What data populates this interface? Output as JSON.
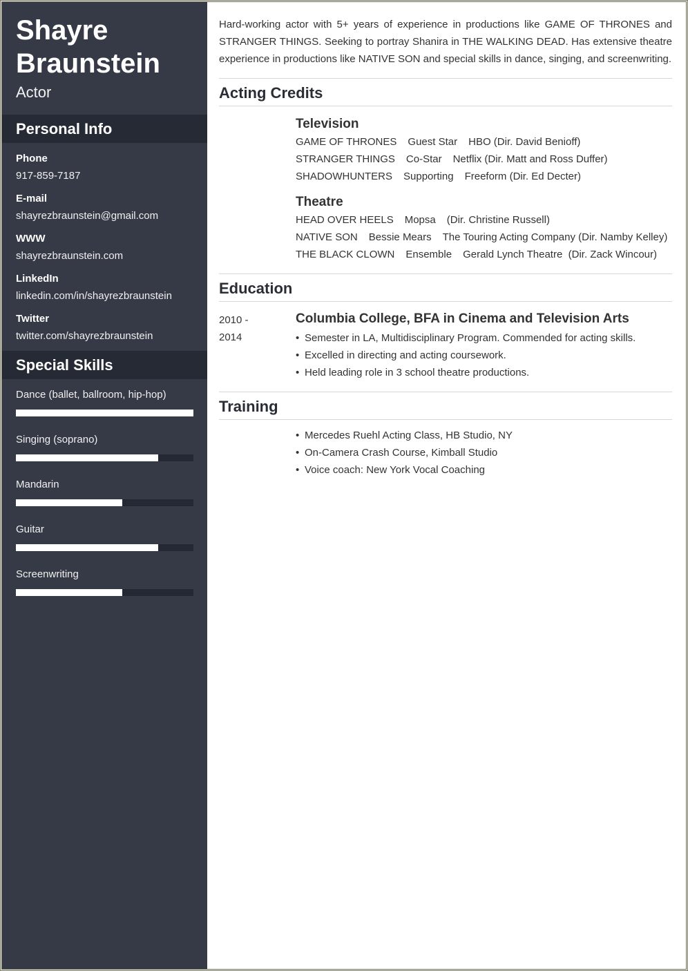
{
  "header": {
    "first_name": "Shayre",
    "last_name": "Braunstein",
    "role": "Actor"
  },
  "personal_info": {
    "title": "Personal Info",
    "items": [
      {
        "label": "Phone",
        "value": "917-859-7187"
      },
      {
        "label": "E-mail",
        "value": "shayrezbraunstein@gmail.com"
      },
      {
        "label": "WWW",
        "value": "shayrezbraunstein.com"
      },
      {
        "label": "LinkedIn",
        "value": "linkedin.com/in/shayrezbraunstein"
      },
      {
        "label": "Twitter",
        "value": "twitter.com/shayrezbraunstein"
      }
    ]
  },
  "skills": {
    "title": "Special Skills",
    "items": [
      {
        "label": "Dance (ballet, ballroom, hip-hop)",
        "level": 1.0
      },
      {
        "label": "Singing (soprano)",
        "level": 0.8
      },
      {
        "label": "Mandarin",
        "level": 0.6
      },
      {
        "label": "Guitar",
        "level": 0.8
      },
      {
        "label": "Screenwriting",
        "level": 0.6
      }
    ]
  },
  "summary": "Hard-working actor with 5+ years of experience in productions like GAME OF THRONES and STRANGER THINGS. Seeking to portray Shanira in THE WALKING DEAD. Has extensive theatre experience in productions like NATIVE SON and special skills in dance, singing, and screenwriting.",
  "acting_credits": {
    "title": "Acting Credits",
    "groups": [
      {
        "title": "Television",
        "credits": [
          {
            "production": "GAME OF THRONES",
            "role": "Guest Star",
            "company": "HBO (Dir. David Benioff)"
          },
          {
            "production": "STRANGER THINGS",
            "role": "Co-Star",
            "company": "Netflix (Dir. Matt and Ross Duffer)"
          },
          {
            "production": "SHADOWHUNTERS",
            "role": "Supporting",
            "company": "Freeform (Dir. Ed Decter)"
          }
        ]
      },
      {
        "title": "Theatre",
        "credits": [
          {
            "production": "HEAD OVER HEELS",
            "role": "Mopsa",
            "company": "(Dir. Christine Russell)"
          },
          {
            "production": "NATIVE SON",
            "role": "Bessie Mears",
            "company": "The Touring Acting Company (Dir. Namby Kelley)"
          },
          {
            "production": "THE BLACK CLOWN",
            "role": "Ensemble",
            "company": "Gerald Lynch Theatre  (Dir. Zack Wincour)"
          }
        ]
      }
    ]
  },
  "education": {
    "title": "Education",
    "entries": [
      {
        "date_start": "2010 -",
        "date_end": "2014",
        "degree": "Columbia College, BFA in Cinema and Television Arts",
        "bullets": [
          "Semester in LA, Multidisciplinary Program. Commended for acting skills.",
          "Excelled in directing and acting coursework.",
          "Held leading role in 3 school theatre productions."
        ]
      }
    ]
  },
  "training": {
    "title": "Training",
    "bullets": [
      "Mercedes Ruehl Acting Class, HB Studio, NY",
      "On-Camera Crash Course, Kimball Studio",
      "Voice coach: New York Vocal Coaching"
    ]
  },
  "colors": {
    "sidebar_bg": "#363a46",
    "sidebar_header_bg": "#262a34",
    "skill_track": "#242832",
    "skill_fill": "#ffffff",
    "text": "#333333"
  }
}
